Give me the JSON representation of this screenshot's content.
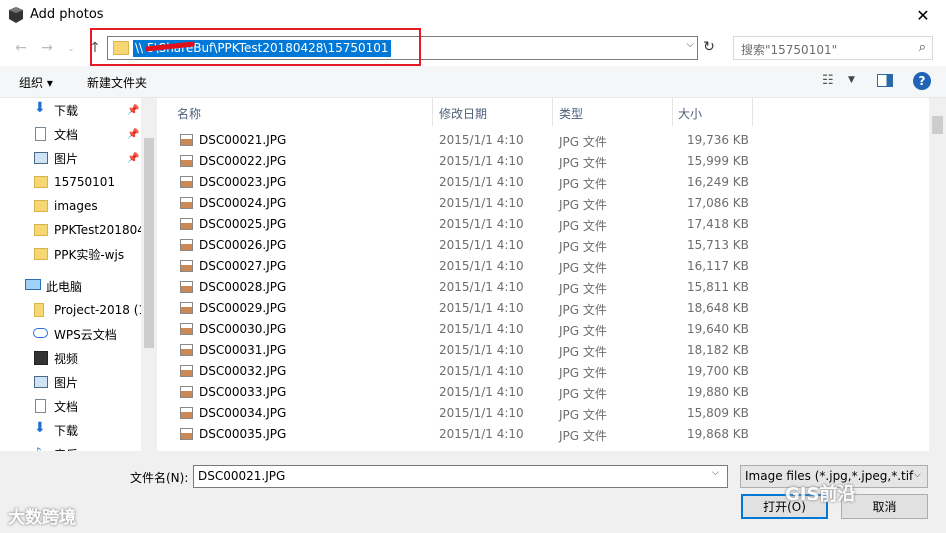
{
  "window": {
    "title": "Add photos"
  },
  "address": {
    "path": "\\\\        5\\ShareBuf\\PPKTest20180428\\15750101"
  },
  "search": {
    "placeholder": "搜索\"15750101\""
  },
  "toolbar": {
    "organize": "组织 ▾",
    "new_folder": "新建文件夹"
  },
  "sidebar": {
    "items": [
      {
        "label": "下载",
        "icon": "download-icon",
        "pinned": true
      },
      {
        "label": "文档",
        "icon": "document-icon",
        "pinned": true
      },
      {
        "label": "图片",
        "icon": "picture-icon",
        "pinned": true
      },
      {
        "label": "15750101",
        "icon": "folder-icon"
      },
      {
        "label": "images",
        "icon": "folder-icon"
      },
      {
        "label": "PPKTest201804",
        "icon": "folder-icon"
      },
      {
        "label": "PPK实验-wjs",
        "icon": "folder-icon"
      },
      {
        "label": "此电脑",
        "icon": "computer-icon"
      },
      {
        "label": "Project-2018 (1",
        "icon": "folder-icon"
      },
      {
        "label": "WPS云文档",
        "icon": "cloud-icon"
      },
      {
        "label": "视频",
        "icon": "video-icon"
      },
      {
        "label": "图片",
        "icon": "picture-icon"
      },
      {
        "label": "文档",
        "icon": "document-icon"
      },
      {
        "label": "下载",
        "icon": "download-icon"
      },
      {
        "label": "音乐",
        "icon": "music-icon"
      }
    ]
  },
  "columns": {
    "name": "名称",
    "date": "修改日期",
    "type": "类型",
    "size": "大小"
  },
  "files": [
    {
      "name": "DSC00021.JPG",
      "date": "2015/1/1 4:10",
      "type": "JPG 文件",
      "size": "19,736 KB"
    },
    {
      "name": "DSC00022.JPG",
      "date": "2015/1/1 4:10",
      "type": "JPG 文件",
      "size": "15,999 KB"
    },
    {
      "name": "DSC00023.JPG",
      "date": "2015/1/1 4:10",
      "type": "JPG 文件",
      "size": "16,249 KB"
    },
    {
      "name": "DSC00024.JPG",
      "date": "2015/1/1 4:10",
      "type": "JPG 文件",
      "size": "17,086 KB"
    },
    {
      "name": "DSC00025.JPG",
      "date": "2015/1/1 4:10",
      "type": "JPG 文件",
      "size": "17,418 KB"
    },
    {
      "name": "DSC00026.JPG",
      "date": "2015/1/1 4:10",
      "type": "JPG 文件",
      "size": "15,713 KB"
    },
    {
      "name": "DSC00027.JPG",
      "date": "2015/1/1 4:10",
      "type": "JPG 文件",
      "size": "16,117 KB"
    },
    {
      "name": "DSC00028.JPG",
      "date": "2015/1/1 4:10",
      "type": "JPG 文件",
      "size": "15,811 KB"
    },
    {
      "name": "DSC00029.JPG",
      "date": "2015/1/1 4:10",
      "type": "JPG 文件",
      "size": "18,648 KB"
    },
    {
      "name": "DSC00030.JPG",
      "date": "2015/1/1 4:10",
      "type": "JPG 文件",
      "size": "19,640 KB"
    },
    {
      "name": "DSC00031.JPG",
      "date": "2015/1/1 4:10",
      "type": "JPG 文件",
      "size": "18,182 KB"
    },
    {
      "name": "DSC00032.JPG",
      "date": "2015/1/1 4:10",
      "type": "JPG 文件",
      "size": "19,700 KB"
    },
    {
      "name": "DSC00033.JPG",
      "date": "2015/1/1 4:10",
      "type": "JPG 文件",
      "size": "19,880 KB"
    },
    {
      "name": "DSC00034.JPG",
      "date": "2015/1/1 4:10",
      "type": "JPG 文件",
      "size": "15,809 KB"
    },
    {
      "name": "DSC00035.JPG",
      "date": "2015/1/1 4:10",
      "type": "JPG 文件",
      "size": "19,868 KB"
    }
  ],
  "filename": {
    "label": "文件名(N):",
    "value": "DSC00021.JPG"
  },
  "filetype": {
    "value": "Image files (*.jpg,*.jpeg,*.tif"
  },
  "buttons": {
    "open": "打开(O)",
    "cancel": "取消"
  },
  "watermarks": {
    "left": "大数跨境",
    "right": "GIS前沿"
  },
  "colors": {
    "selection": "#0078d7",
    "highlight": "#e51c23",
    "folder": "#f7d774"
  }
}
